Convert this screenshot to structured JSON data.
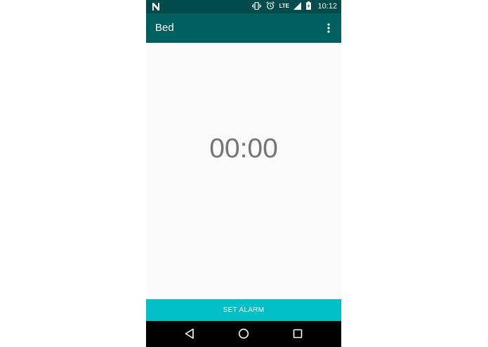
{
  "status_bar": {
    "left_icon": "notification-n-icon",
    "icons": [
      "vibrate-icon",
      "alarm-clock-icon",
      "lte-signal-icon",
      "battery-charging-icon"
    ],
    "network_label": "LTE",
    "time": "10:12"
  },
  "app_bar": {
    "title": "Bed",
    "menu_icon": "overflow-menu-icon"
  },
  "main": {
    "time_display": "00:00"
  },
  "button": {
    "label": "SET ALARM"
  },
  "nav_bar": {
    "icons": [
      "back-icon",
      "home-icon",
      "recents-icon"
    ]
  },
  "colors": {
    "status_bar": "#004c4c",
    "app_bar": "#006060",
    "accent": "#00bfc7",
    "background": "#fafafa",
    "time_text": "#757575",
    "nav_bar": "#000000"
  }
}
